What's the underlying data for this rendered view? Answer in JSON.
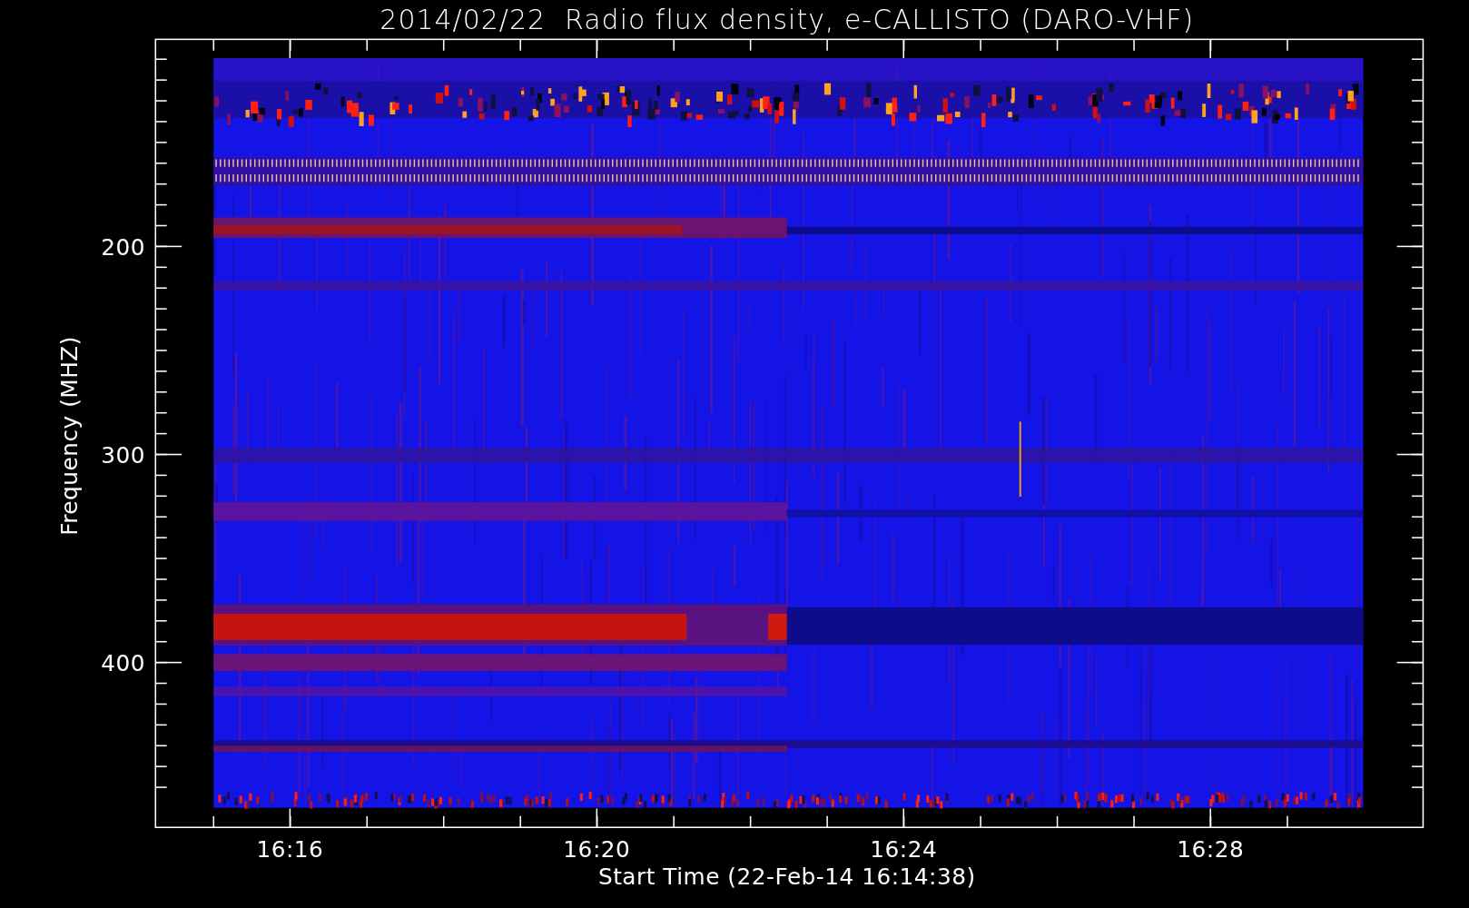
{
  "title": "2014/02/22  Radio flux density, e-CALLISTO (DARO-VHF)",
  "y_axis": {
    "label": "Frequency (MHZ)",
    "tick_labels": [
      "200",
      "300",
      "400"
    ]
  },
  "x_axis": {
    "label": "Start Time (22-Feb-14 16:14:38)",
    "tick_labels": [
      "16:16",
      "16:20",
      "16:24",
      "16:28"
    ]
  }
}
